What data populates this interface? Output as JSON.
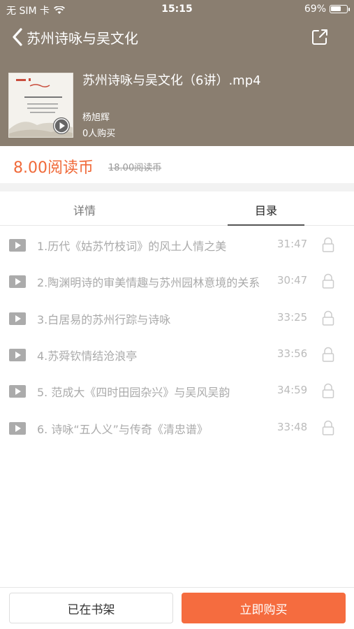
{
  "status_bar": {
    "carrier": "无 SIM 卡",
    "time": "15:15",
    "battery_text": "69%",
    "battery_level": 0.69,
    "wifi_icon": "wifi-icon"
  },
  "nav": {
    "title": "苏州诗咏与吴文化",
    "back_icon": "chevron-left-icon",
    "share_icon": "share-icon"
  },
  "course": {
    "title": "苏州诗咏与吴文化（6讲）.mp4",
    "author": "杨旭辉",
    "buyers": "0人购买",
    "play_icon": "play-icon"
  },
  "price": {
    "current": "8.00阅读币",
    "original": "18.00阅读币"
  },
  "tabs": [
    {
      "label": "详情",
      "active": false
    },
    {
      "label": "目录",
      "active": true
    }
  ],
  "lessons": [
    {
      "title": "1.历代《姑苏竹枝词》的风土人情之美",
      "duration": "31:47"
    },
    {
      "title": "2.陶渊明诗的审美情趣与苏州园林意境的关系",
      "duration": "30:47"
    },
    {
      "title": "3.白居易的苏州行踪与诗咏",
      "duration": "33:25"
    },
    {
      "title": "4.苏舜钦情结沧浪亭",
      "duration": "33:56"
    },
    {
      "title": "5. 范成大《四时田园杂兴》与吴风吴韵",
      "duration": "34:59"
    },
    {
      "title": "6. 诗咏“五人义”与传奇《清忠谱》",
      "duration": "33:48"
    }
  ],
  "bottom": {
    "shelf_label": "已在书架",
    "buy_label": "立即购买"
  },
  "colors": {
    "header_bg": "#8a7e70",
    "accent": "#f06a3a",
    "buy_button": "#f56c3f"
  }
}
